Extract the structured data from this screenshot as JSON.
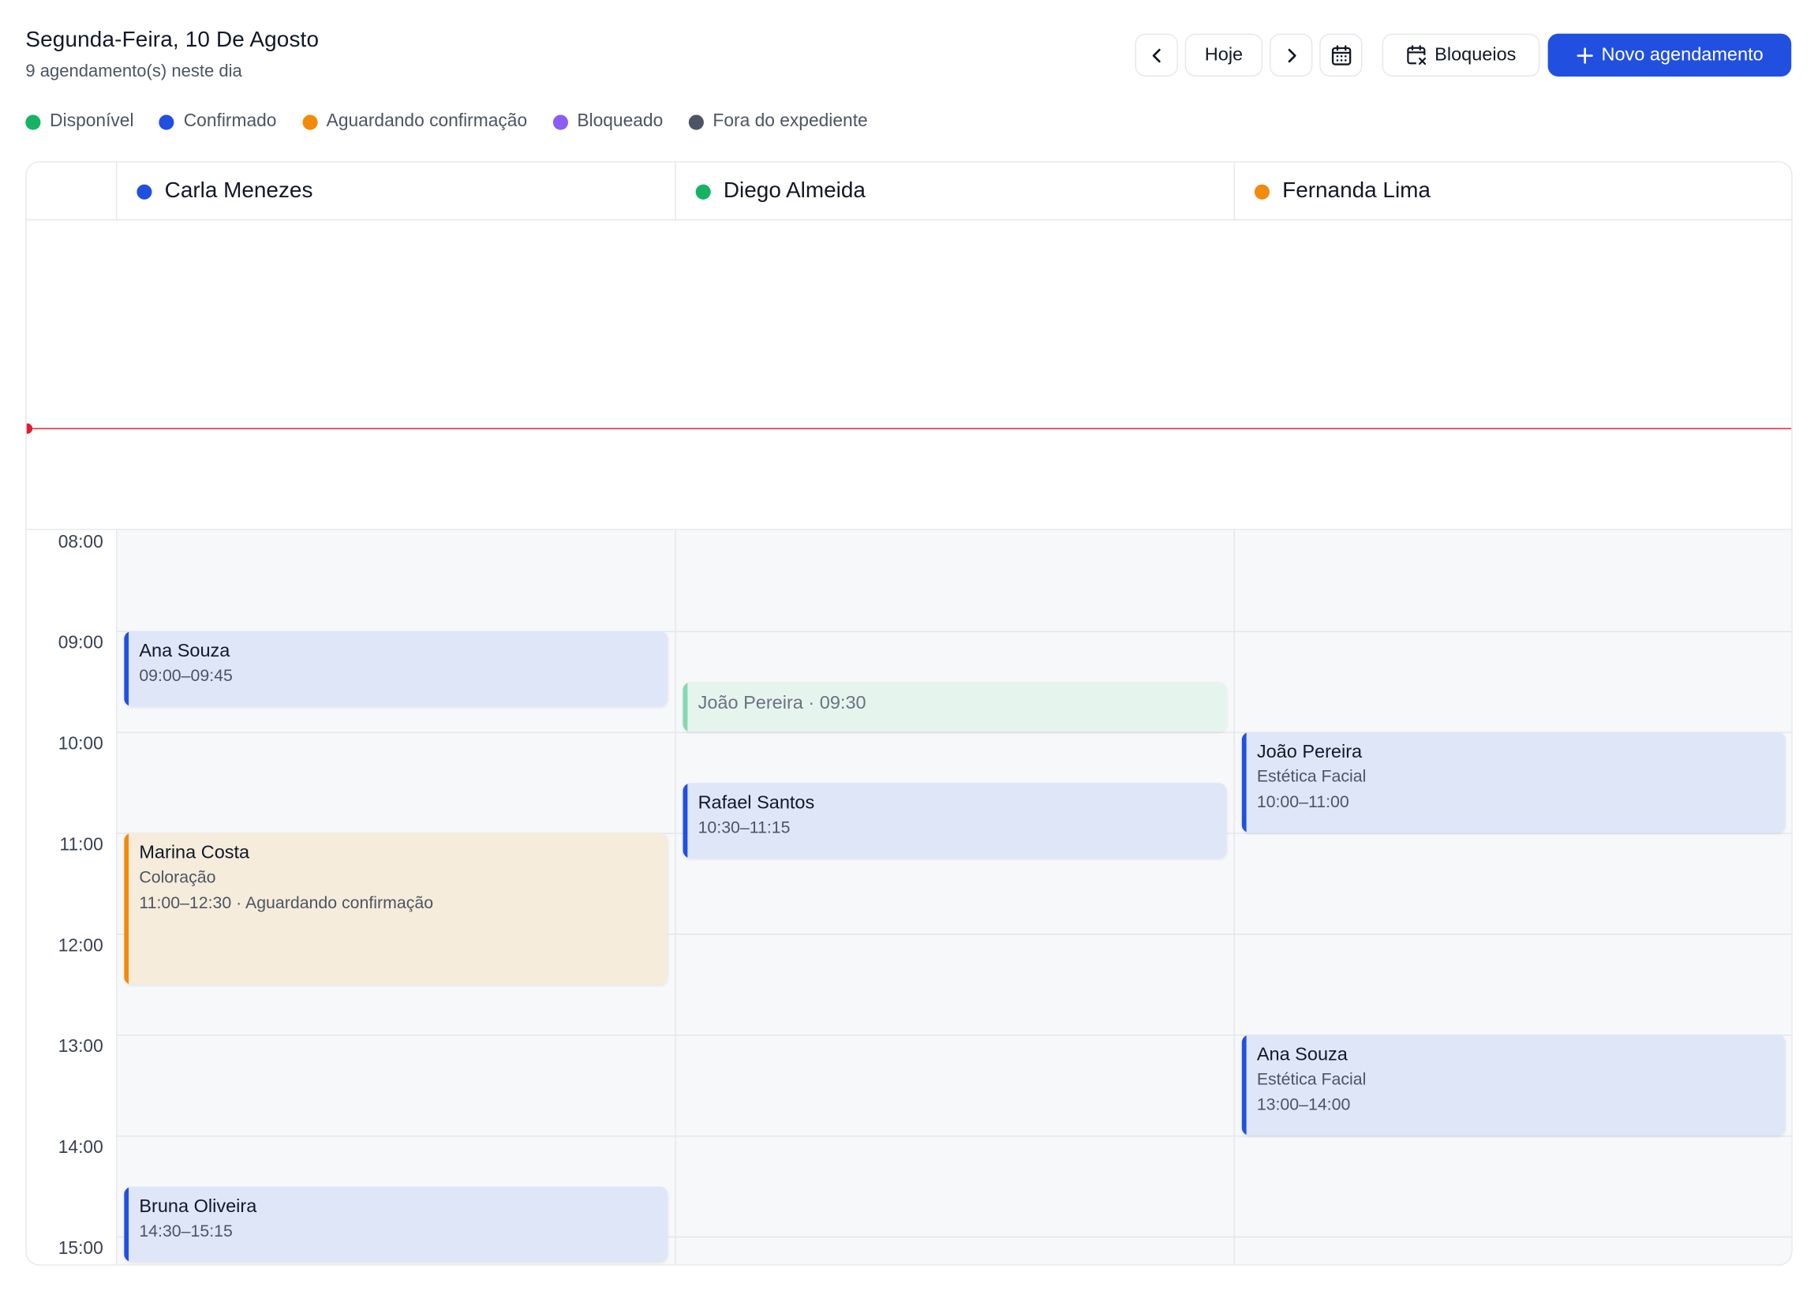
{
  "header": {
    "title": "Segunda-Feira, 10 De Agosto",
    "subtitle": "9 agendamento(s) neste dia"
  },
  "toolbar": {
    "prev_icon": "chevron-left-icon",
    "today_label": "Hoje",
    "next_icon": "chevron-right-icon",
    "calendar_icon": "calendar-icon",
    "blocks_label": "Bloqueios",
    "blocks_icon": "calendar-x-icon",
    "new_label": "Novo agendamento",
    "new_icon": "plus-icon"
  },
  "legend": [
    {
      "label": "Disponível",
      "color": "#16b364"
    },
    {
      "label": "Confirmado",
      "color": "#2150e0"
    },
    {
      "label": "Aguardando confirmação",
      "color": "#f28a0c"
    },
    {
      "label": "Bloqueado",
      "color": "#8b5cf6"
    },
    {
      "label": "Fora do expediente",
      "color": "#4b5563"
    }
  ],
  "professionals": [
    {
      "name": "Carla Menezes",
      "color": "#2150e0"
    },
    {
      "name": "Diego Almeida",
      "color": "#16b364"
    },
    {
      "name": "Fernanda Lima",
      "color": "#f28a0c"
    }
  ],
  "hours": [
    "08:00",
    "09:00",
    "10:00",
    "11:00",
    "12:00",
    "13:00",
    "14:00",
    "15:00"
  ],
  "appointments": {
    "carla": [
      {
        "name": "Ana Souza",
        "time": "09:00–09:45",
        "status": "confirmado"
      },
      {
        "name": "Marina Costa",
        "service": "Coloração",
        "time": "11:00–12:30 · Aguardando confirmação",
        "status": "aguardando"
      },
      {
        "name": "Bruna Oliveira",
        "time": "14:30–15:15",
        "status": "confirmado"
      }
    ],
    "diego": [
      {
        "name": "João Pereira · 09:30",
        "status": "disponivel"
      },
      {
        "name": "Rafael Santos",
        "time": "10:30–11:15",
        "status": "confirmado"
      }
    ],
    "fernanda": [
      {
        "name": "João Pereira",
        "service": "Estética Facial",
        "time": "10:00–11:00",
        "status": "confirmado"
      },
      {
        "name": "Ana Souza",
        "service": "Estética Facial",
        "time": "13:00–14:00",
        "status": "confirmado"
      }
    ]
  }
}
